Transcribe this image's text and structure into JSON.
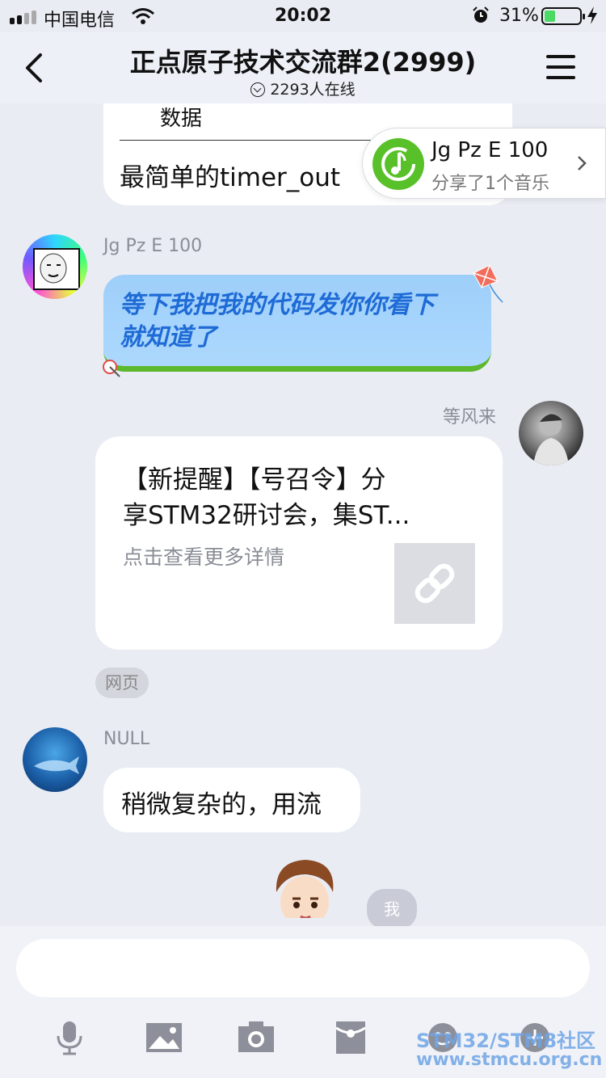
{
  "status_bar": {
    "carrier": "中国电信",
    "time": "20:02",
    "battery_percent": "31%",
    "battery_level": 0.31,
    "icons": [
      "signal-icon",
      "wifi-icon",
      "alarm-icon",
      "battery-icon",
      "charging-icon"
    ]
  },
  "header": {
    "title": "正点原子技术交流群2(2999)",
    "online": "2293人在线",
    "back_icon": "chevron-left-icon",
    "menu_icon": "hamburger-menu-icon"
  },
  "messages": {
    "card_top": {
      "line1": "数据",
      "line2": "最简单的timer_out"
    },
    "music_popup": {
      "name": "Jg Pz E 100",
      "subtitle": "分享了1个音乐",
      "icon": "music-note-icon"
    },
    "msg1": {
      "sender": "Jg Pz E 100",
      "text_line1": "等下我把我的代码发你你看下",
      "text_line2": "就知道了"
    },
    "msg2": {
      "sender": "等风来",
      "title_line1": "【新提醒】【号召令】分",
      "title_line2": "享STM32研讨会，集ST...",
      "desc": "点击查看更多详情",
      "thumb_icon": "link-icon",
      "tag": "网页"
    },
    "msg3": {
      "sender": "NULL",
      "text": "稍微复杂的，用流"
    },
    "me_tag": "我"
  },
  "input_bar": {
    "value": "",
    "tools": [
      "microphone-icon",
      "image-icon",
      "camera-icon",
      "red-packet-icon",
      "emoji-icon",
      "plus-icon"
    ]
  },
  "watermark": {
    "line1": "STM32/STM8社区",
    "line2": "www.stmcu.org.cn"
  },
  "colors": {
    "background": "#eaecf4",
    "bubble_blue": "#a2d2fb",
    "accent_green": "#58c12a",
    "link_text": "#1f6bd6"
  }
}
